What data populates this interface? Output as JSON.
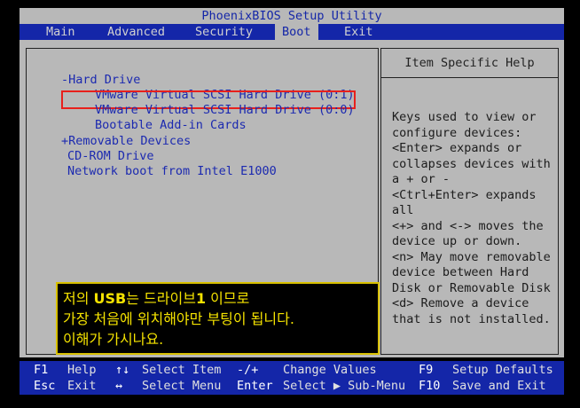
{
  "title": "PhoenixBIOS Setup Utility",
  "menu": {
    "items": [
      "Main",
      "Advanced",
      "Security",
      "Boot",
      "Exit"
    ],
    "active": "Boot"
  },
  "boot_list": [
    {
      "label": "-Hard Drive",
      "selected": false
    },
    {
      "label": "VMware Virtual SCSI Hard Drive (0:1)",
      "selected": true
    },
    {
      "label": "VMware Virtual SCSI Hard Drive (0:0)",
      "selected": false
    },
    {
      "label": "Bootable Add-in Cards",
      "selected": false
    },
    {
      "label": "+Removable Devices",
      "selected": false
    },
    {
      "label": "CD-ROM Drive",
      "selected": false
    },
    {
      "label": "Network boot from Intel E1000",
      "selected": false
    }
  ],
  "help": {
    "title": "Item Specific Help",
    "lines": [
      "Keys used to view or",
      "configure devices:",
      "<Enter> expands or",
      "collapses devices with",
      "a + or -",
      "<Ctrl+Enter> expands",
      "all",
      "<+> and <-> moves the",
      "device up or down.",
      "<n> May move removable",
      "device between Hard",
      "Disk or Removable Disk",
      "<d> Remove a device",
      "that is not installed."
    ]
  },
  "annotation": {
    "line1_a": "저의 ",
    "line1_b": "USB",
    "line1_c": "는 드라이브",
    "line1_d": "1",
    "line1_e": " 이므로",
    "line2": "가장 처음에 위치해야만 부팅이 됩니다.",
    "line3": "이해가 가시나요."
  },
  "statusbar": {
    "row1": [
      {
        "key": "F1",
        "action": "Help"
      },
      {
        "key": "↑↓",
        "action": "Select Item"
      },
      {
        "key": "-/+",
        "action": "Change Values"
      },
      {
        "key": "F9",
        "action": "Setup Defaults"
      }
    ],
    "row2": [
      {
        "key": "Esc",
        "action": "Exit"
      },
      {
        "key": "↔",
        "action": "Select Menu"
      },
      {
        "key": "Enter",
        "action": "Select ▶ Sub-Menu"
      },
      {
        "key": "F10",
        "action": "Save and Exit"
      }
    ]
  },
  "colors": {
    "blue": "#1426a8",
    "gray": "#b8b8b8",
    "selection_border": "#e8201c",
    "annotation_text": "#f4e200"
  }
}
